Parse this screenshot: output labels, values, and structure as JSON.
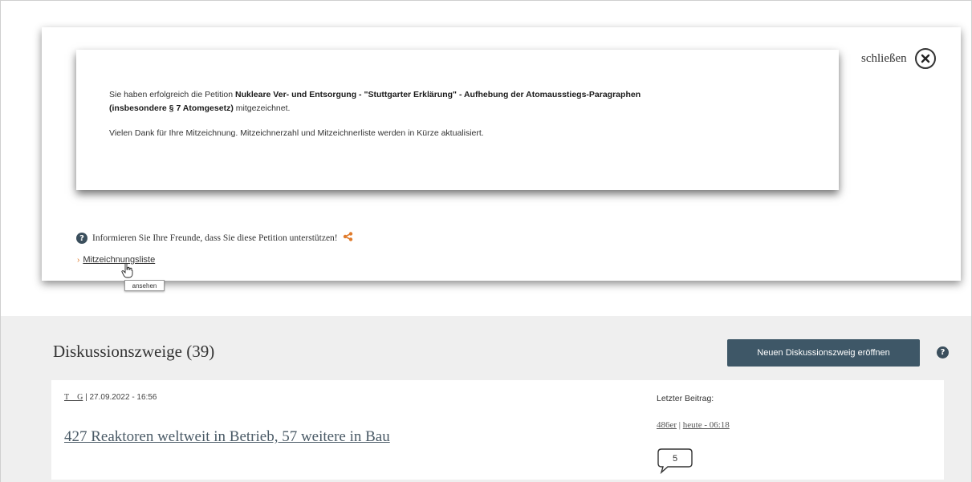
{
  "modal": {
    "close_label": "schließen",
    "message": {
      "prefix": "Sie haben erfolgreich die Petition ",
      "petition_title": "Nukleare Ver- und Entsorgung - \"Stuttgarter Erklärung\" - Aufhebung der Atomausstiegs-Paragraphen",
      "petition_title_line2": "(insbesondere § 7 Atomgesetz)",
      "suffix": " mitgezeichnet.",
      "thanks": "Vielen Dank für Ihre Mitzeichnung. Mitzeichnerzahl und Mitzeichnerliste werden in Kürze aktualisiert."
    },
    "share_text": "Informieren Sie Ihre Freunde, dass Sie diese Petition unterstützen!",
    "list_link": "Mitzeichnungsliste",
    "tooltip": "ansehen"
  },
  "discussion": {
    "title": "Diskussionszweige (39)",
    "new_button": "Neuen Diskussionszweig eröffnen",
    "thread": {
      "author": "T__G",
      "separator": " | ",
      "date": "27.09.2022 - 16:56",
      "title": "427 Reaktoren weltweit in Betrieb, 57 weitere in Bau",
      "last_label": "Letzter Beitrag:",
      "last_author": "486er",
      "last_time": "heute - 06:18",
      "reply_count": "5"
    }
  },
  "colors": {
    "button_bg": "#3e5767",
    "share_accent": "#e07b2c",
    "section_bg": "#efefef"
  },
  "icons": {
    "close": "close-circle-icon",
    "help": "question-circle-icon",
    "share": "share-icon",
    "cursor": "hand-pointer-icon",
    "reply": "speech-bubble-icon"
  }
}
